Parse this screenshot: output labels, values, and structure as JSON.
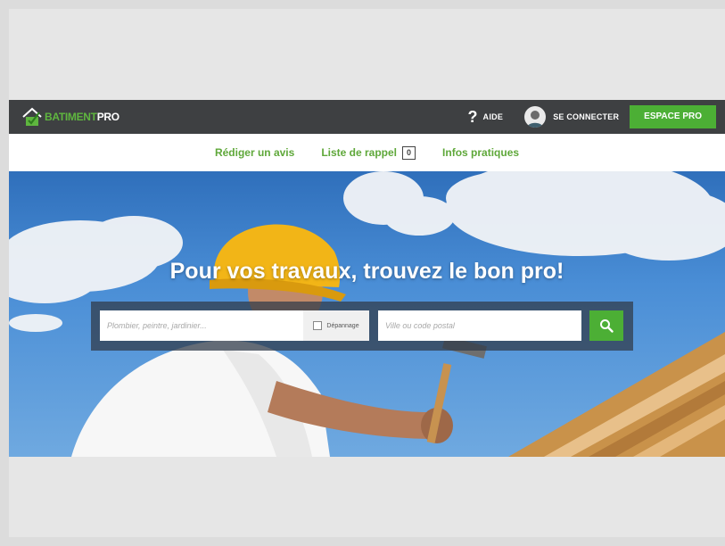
{
  "brand": {
    "name_part1": "BATIMENT",
    "name_part2": "PRO"
  },
  "topbar": {
    "help_label": "AIDE",
    "login_label": "SE CONNECTER",
    "pro_button": "ESPACE PRO"
  },
  "nav": {
    "review": "Rédiger un avis",
    "callback_list": "Liste de rappel",
    "callback_count": "0",
    "info": "Infos pratiques"
  },
  "hero": {
    "headline": "Pour vos travaux, trouvez le bon pro!"
  },
  "search": {
    "what_placeholder": "Plombier, peintre, jardinier...",
    "emergency_label": "Dépannage",
    "where_placeholder": "Ville ou code postal"
  },
  "colors": {
    "accent": "#4caf35",
    "topbar": "#3e4042"
  }
}
